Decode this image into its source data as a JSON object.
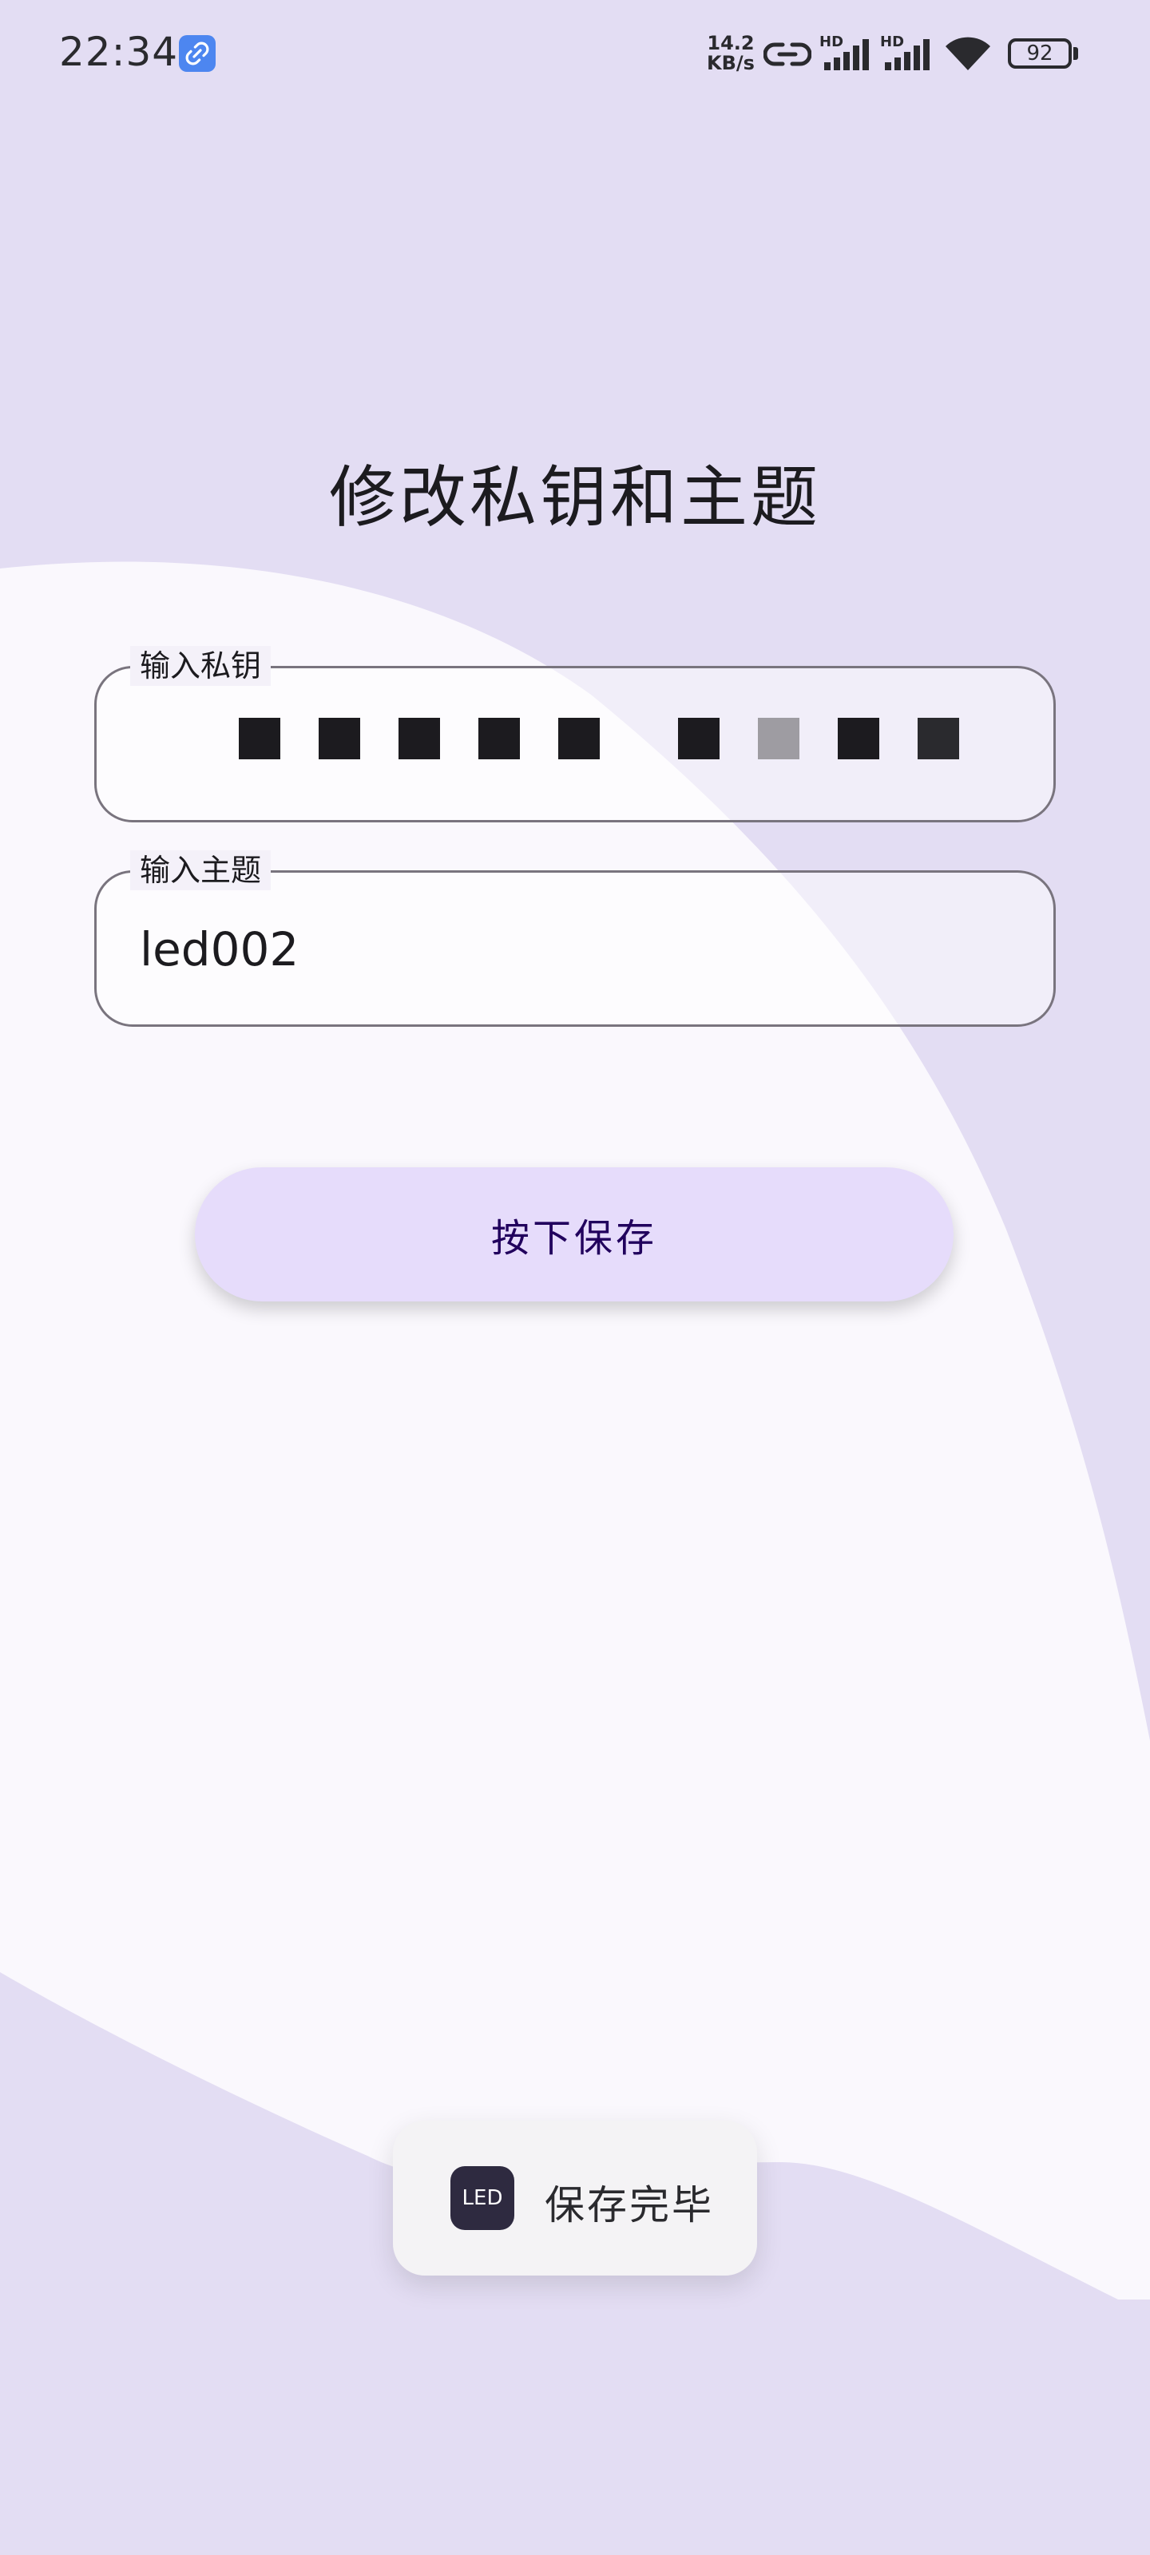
{
  "status_bar": {
    "time": "22:34",
    "net_speed_value": "14.2",
    "net_speed_unit": "KB/s",
    "signal_1_label": "HD",
    "signal_2_label": "HD",
    "battery": "92",
    "icons": [
      "link-app-icon",
      "link-icon",
      "cellular-signal-icon",
      "cellular-signal-icon",
      "wifi-icon",
      "battery-icon"
    ]
  },
  "page": {
    "title": "修改私钥和主题",
    "private_key_field": {
      "label": "输入私钥",
      "masked_value": "■■■■■ ■■■■"
    },
    "topic_field": {
      "label": "输入主题",
      "value": "led002"
    },
    "save_button_label": "按下保存"
  },
  "toast": {
    "app_icon_text": "LED",
    "message": "保存完毕"
  },
  "colors": {
    "background": "#e3ddf3",
    "surface": "#faf8fd",
    "button": "#e6dcfb",
    "button_text": "#21005d",
    "outline": "#79747e"
  }
}
